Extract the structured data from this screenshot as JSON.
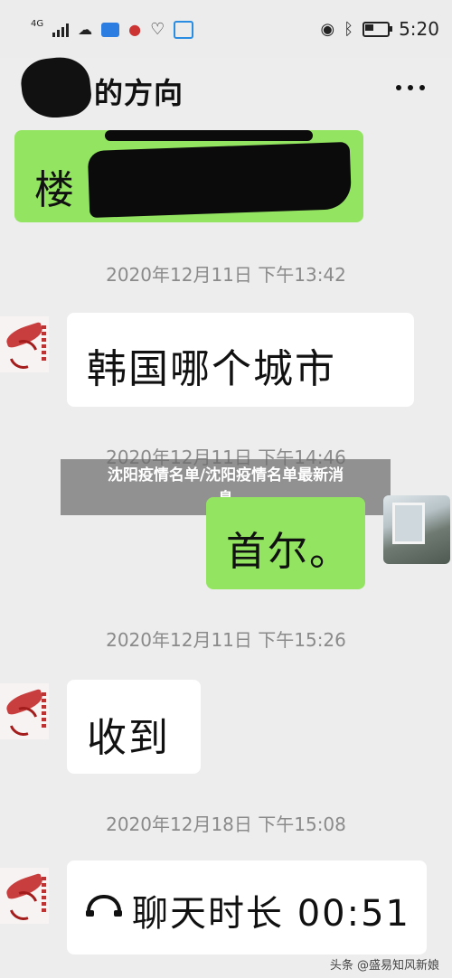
{
  "status_bar": {
    "network": "4G",
    "time": "5:20",
    "icons": [
      "signal-icon",
      "wechat-icon",
      "app-icon",
      "location-pin-icon",
      "heart-icon",
      "photo-icon",
      "eye-icon",
      "bluetooth-icon",
      "battery-icon"
    ],
    "battery_level": 0.35
  },
  "header": {
    "title": "的方向",
    "more_icon": "more-icon"
  },
  "messages": [
    {
      "side": "right",
      "type": "text",
      "text": "楼",
      "redacted": true
    },
    {
      "type": "timestamp",
      "text": "2020年12月11日 下午13:42"
    },
    {
      "side": "left",
      "type": "text",
      "text": "韩国哪个城市"
    },
    {
      "type": "timestamp",
      "text": "2020年12月11日 下午14:46"
    },
    {
      "side": "right",
      "type": "text",
      "text": "首尔。"
    },
    {
      "type": "timestamp",
      "text": "2020年12月11日 下午15:26"
    },
    {
      "side": "left",
      "type": "text",
      "text": "收到"
    },
    {
      "type": "timestamp",
      "text": "2020年12月18日 下午15:08"
    },
    {
      "side": "left",
      "type": "call",
      "text": "聊天时长 00:51",
      "icon": "phone-hangup-icon"
    }
  ],
  "overlay_banner": {
    "line1": "沈阳疫情名单/沈阳疫情名单最新消",
    "line2": "息"
  },
  "watermark": "头条 @盛易知风新娘",
  "colors": {
    "green_bubble": "#93e561",
    "background": "#ededed"
  }
}
